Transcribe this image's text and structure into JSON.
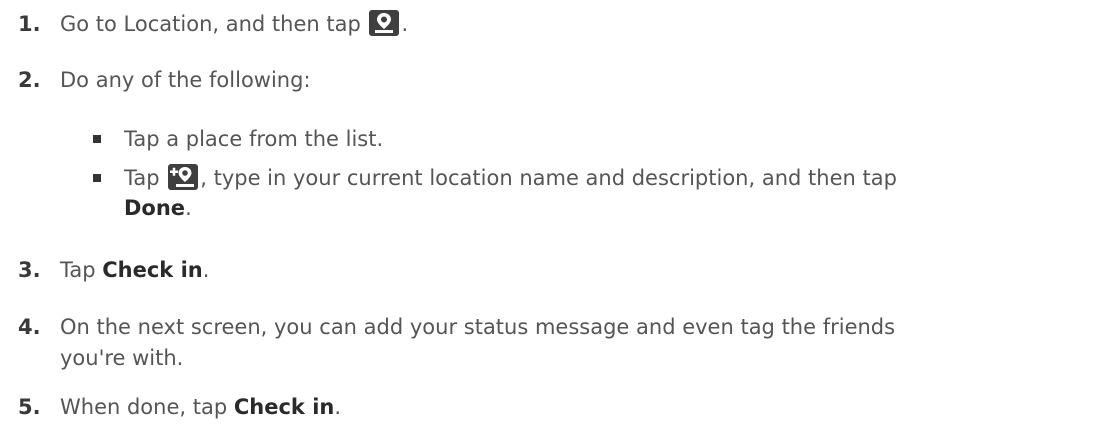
{
  "steps": {
    "s1": {
      "num": "1.",
      "before": "Go to Location, and then tap ",
      "icon": "location-pin-icon",
      "after": "."
    },
    "s2": {
      "num": "2.",
      "text": "Do any of the following:"
    },
    "b1": {
      "text": "Tap a place from the list."
    },
    "b2": {
      "before": "Tap ",
      "icon": "add-location-icon",
      "mid": ", type in your current location name and description, and then tap",
      "ui": "Done",
      "after": "."
    },
    "s3": {
      "num": "3.",
      "before": "Tap ",
      "ui": "Check in",
      "after": "."
    },
    "s4": {
      "num": "4.",
      "line1": "On the next screen, you can add your status message and even tag the friends",
      "line2": "you're with."
    },
    "s5": {
      "num": "5.",
      "before": "When done, tap ",
      "ui": "Check in",
      "after": "."
    }
  },
  "colors": {
    "text": "#555555",
    "icon_bg": "#3f3f3f",
    "icon_fg": "#ffffff"
  }
}
